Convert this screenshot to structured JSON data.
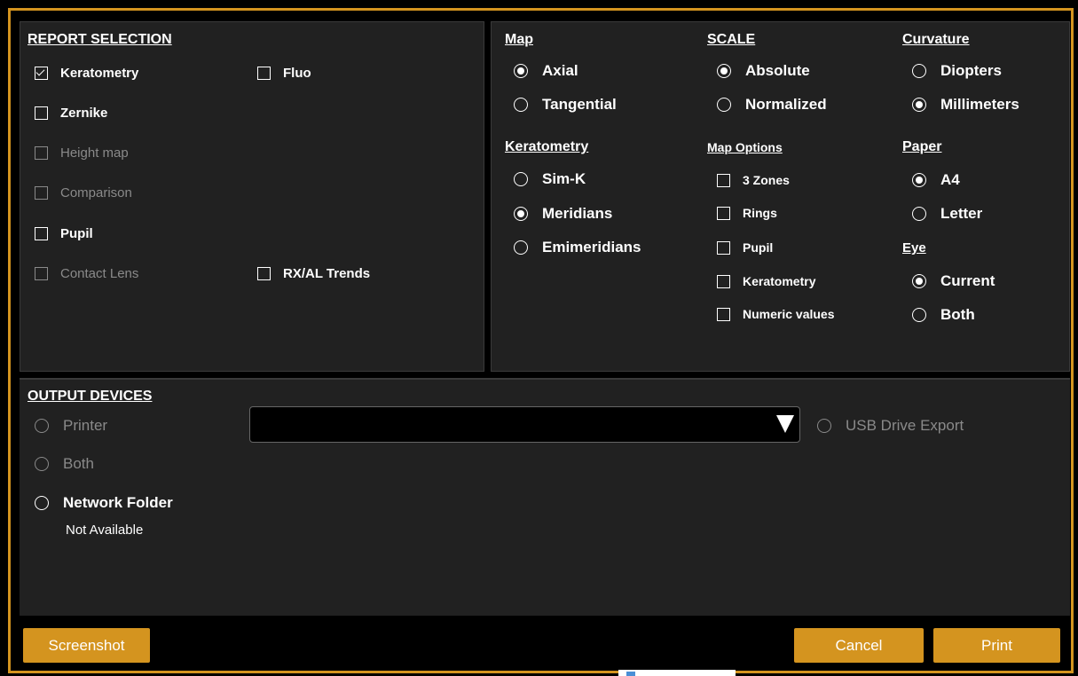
{
  "report_selection": {
    "header": "REPORT SELECTION",
    "items": [
      {
        "label": "Keratometry",
        "checked": true,
        "enabled": true
      },
      {
        "label": "Fluo",
        "checked": false,
        "enabled": true
      },
      {
        "label": "Zernike",
        "checked": false,
        "enabled": true
      },
      {
        "label": "Height map",
        "checked": false,
        "enabled": false
      },
      {
        "label": "Comparison",
        "checked": false,
        "enabled": false
      },
      {
        "label": "Pupil",
        "checked": false,
        "enabled": true
      },
      {
        "label": "Contact Lens",
        "checked": false,
        "enabled": false
      },
      {
        "label": "RX/AL Trends",
        "checked": false,
        "enabled": true
      }
    ]
  },
  "map": {
    "header": "Map",
    "options": [
      {
        "label": "Axial",
        "selected": true
      },
      {
        "label": "Tangential",
        "selected": false
      }
    ]
  },
  "scale": {
    "header": "SCALE",
    "options": [
      {
        "label": "Absolute",
        "selected": true
      },
      {
        "label": "Normalized",
        "selected": false
      }
    ]
  },
  "curvature": {
    "header": "Curvature",
    "options": [
      {
        "label": "Diopters",
        "selected": false
      },
      {
        "label": "Millimeters",
        "selected": true
      }
    ]
  },
  "keratometry": {
    "header": "Keratometry",
    "options": [
      {
        "label": "Sim-K",
        "selected": false
      },
      {
        "label": "Meridians",
        "selected": true
      },
      {
        "label": "Emimeridians",
        "selected": false
      }
    ]
  },
  "map_options": {
    "header": "Map Options",
    "items": [
      {
        "label": "3 Zones",
        "checked": false
      },
      {
        "label": "Rings",
        "checked": false
      },
      {
        "label": "Pupil",
        "checked": false
      },
      {
        "label": "Keratometry",
        "checked": false
      },
      {
        "label": "Numeric values",
        "checked": false
      }
    ]
  },
  "paper": {
    "header": "Paper",
    "options": [
      {
        "label": "A4",
        "selected": true
      },
      {
        "label": "Letter",
        "selected": false
      }
    ]
  },
  "eye": {
    "header": "Eye",
    "options": [
      {
        "label": "Current",
        "selected": true
      },
      {
        "label": "Both",
        "selected": false
      }
    ]
  },
  "output_devices": {
    "header": "OUTPUT DEVICES",
    "printer_label": "Printer",
    "both_label": "Both",
    "network_folder_label": "Network Folder",
    "network_status": "Not Available",
    "usb_label": "USB Drive Export",
    "printer_select_value": ""
  },
  "buttons": {
    "screenshot": "Screenshot",
    "cancel": "Cancel",
    "print": "Print"
  },
  "colors": {
    "accent": "#d4941f",
    "panel": "#212121",
    "disabled_text": "#8a8a8a"
  }
}
